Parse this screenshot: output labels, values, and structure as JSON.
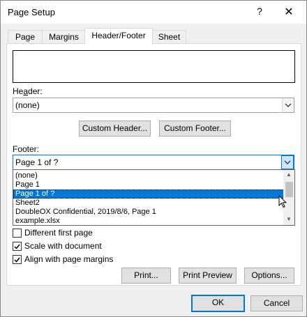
{
  "window": {
    "title": "Page Setup",
    "help": "?",
    "close": "✕"
  },
  "tabs": [
    {
      "label": "Page",
      "active": false
    },
    {
      "label": "Margins",
      "active": false
    },
    {
      "label": "Header/Footer",
      "active": true
    },
    {
      "label": "Sheet",
      "active": false
    }
  ],
  "header": {
    "label": "Header:",
    "accel_letter": "a",
    "value": "(none)"
  },
  "buttons": {
    "custom_header": "Custom Header...",
    "custom_footer": "Custom Footer...",
    "print": "Print...",
    "print_preview": "Print Preview",
    "options": "Options...",
    "ok": "OK",
    "cancel": "Cancel"
  },
  "footer": {
    "label": "Footer:",
    "value": "Page 1 of ?",
    "options": [
      "(none)",
      "Page 1",
      "Page 1 of ?",
      "Sheet2",
      "DoubleOX Confidential, 2019/8/6, Page 1",
      "example.xlsx"
    ],
    "selected_index": 2
  },
  "checkboxes": [
    {
      "label": "Different first page",
      "checked": false
    },
    {
      "label": "Scale with document",
      "checked": true
    },
    {
      "label": "Align with page margins",
      "checked": true
    }
  ]
}
